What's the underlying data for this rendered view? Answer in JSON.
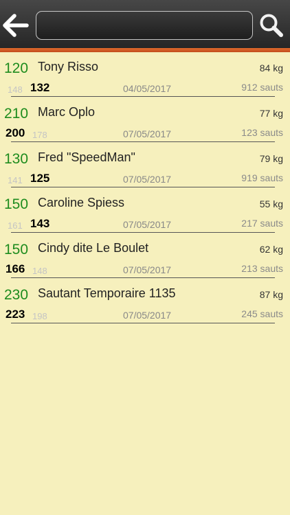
{
  "header": {
    "back_icon": "arrow-left-icon",
    "search_icon": "magnifier-icon",
    "search_value": "",
    "search_placeholder": ""
  },
  "colors": {
    "background": "#f6f0bd",
    "accent_green": "#1e8c1e",
    "header_dark": "#2b2b2b",
    "header_rule": "#d75a22"
  },
  "rows": [
    {
      "num": "120",
      "name": "Tony Risso",
      "weight": "84 kg",
      "big": "132",
      "small": "148",
      "date": "04/05/2017",
      "jumps": "912 sauts"
    },
    {
      "num": "210",
      "name": "Marc Oplo",
      "weight": "77 kg",
      "big": "200",
      "small": "178",
      "date": "07/05/2017",
      "jumps": "123 sauts"
    },
    {
      "num": "130",
      "name": "Fred \"SpeedMan\"",
      "weight": "79 kg",
      "big": "125",
      "small": "141",
      "date": "07/05/2017",
      "jumps": "919 sauts"
    },
    {
      "num": "150",
      "name": "Caroline Spiess",
      "weight": "55 kg",
      "big": "143",
      "small": "161",
      "date": "07/05/2017",
      "jumps": "217 sauts"
    },
    {
      "num": "150",
      "name": "Cindy dite Le Boulet",
      "weight": "62 kg",
      "big": "166",
      "small": "148",
      "date": "07/05/2017",
      "jumps": "213 sauts"
    },
    {
      "num": "230",
      "name": "Sautant Temporaire 1135",
      "weight": "87 kg",
      "big": "223",
      "small": "198",
      "date": "07/05/2017",
      "jumps": "245 sauts"
    }
  ]
}
